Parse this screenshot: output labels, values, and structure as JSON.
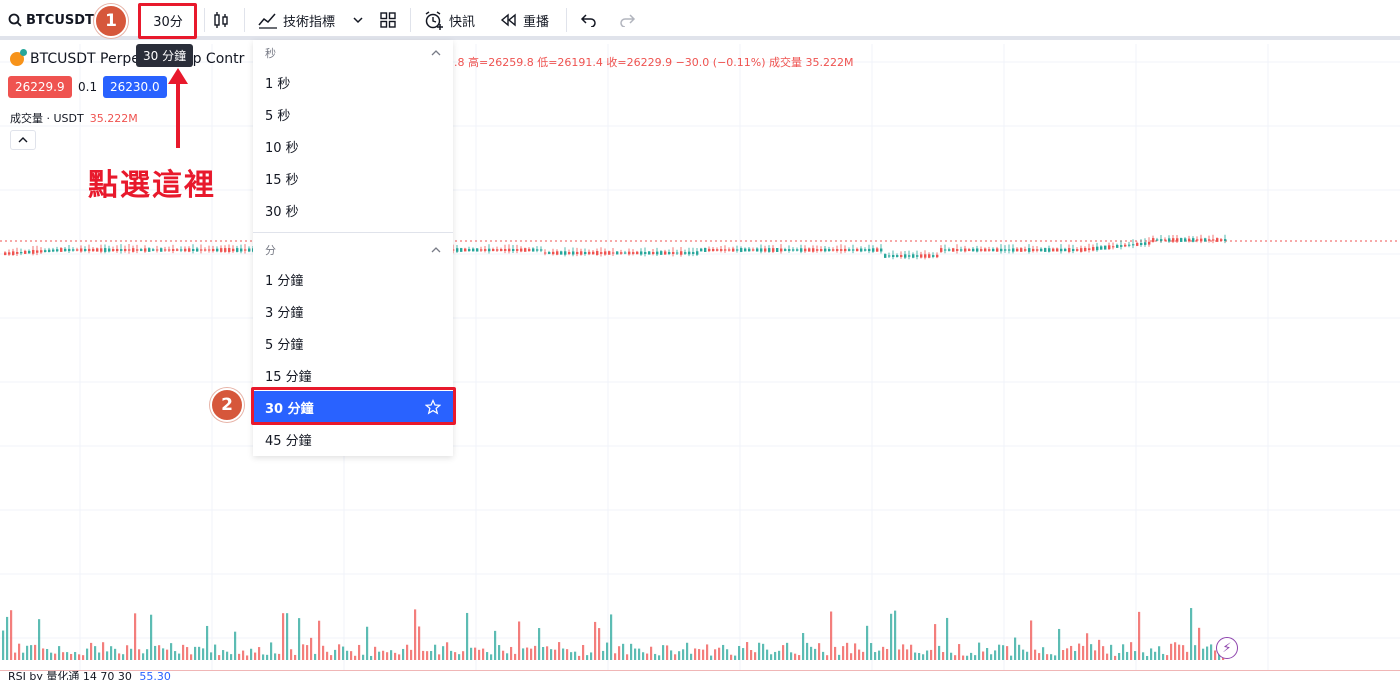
{
  "toolbar": {
    "symbol": "BTCUSDT",
    "interval": "30分",
    "indicators_label": "技術指標",
    "alert_label": "快訊",
    "replay_label": "重播"
  },
  "tooltip": "30 分鐘",
  "annotations": {
    "step1": "1",
    "step2": "2",
    "click_here": "點選這裡",
    "accent_color": "#e8192c"
  },
  "legend": {
    "title": "BTCUSDT Perpe",
    "title_tail": "ap Contr",
    "ohlc": ".8  高=26259.8  低=26191.4  收=26229.9  −30.0 (−0.11%)  成交量 35.222M",
    "sell_price": "26229.9",
    "spread": "0.1",
    "buy_price": "26230.0",
    "volume_label": "成交量 · USDT",
    "volume_value": "35.222M"
  },
  "dropdown": {
    "seconds_header": "秒",
    "seconds": [
      "1 秒",
      "5 秒",
      "10 秒",
      "15 秒",
      "30 秒"
    ],
    "minutes_header": "分",
    "minutes": [
      "1 分鐘",
      "3 分鐘",
      "5 分鐘",
      "15 分鐘"
    ],
    "selected": "30 分鐘",
    "after": [
      "45 分鐘"
    ]
  },
  "rsi_label": "RSI by 量化通 14 70 30",
  "rsi_value": "55.30",
  "colors": {
    "up": "#26a69a",
    "down": "#ef5350",
    "selected_bg": "#2962ff"
  }
}
